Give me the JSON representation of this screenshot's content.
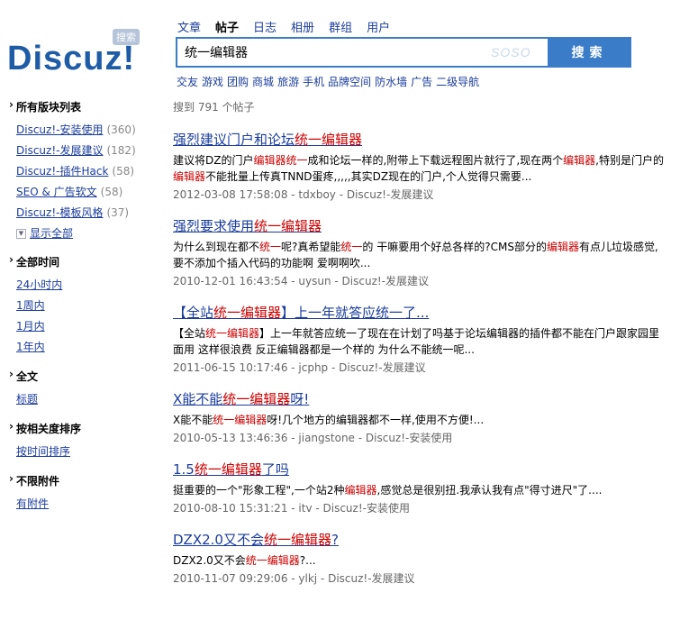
{
  "logo": {
    "text": "Discuz!",
    "badge": "搜索"
  },
  "tabs": [
    {
      "label": "文章",
      "active": false
    },
    {
      "label": "帖子",
      "active": true
    },
    {
      "label": "日志",
      "active": false
    },
    {
      "label": "相册",
      "active": false
    },
    {
      "label": "群组",
      "active": false
    },
    {
      "label": "用户",
      "active": false
    }
  ],
  "search": {
    "value": "统一编辑器",
    "brand": "SOSO",
    "button": "搜索"
  },
  "quicklinks": [
    "交友",
    "游戏",
    "团购",
    "商城",
    "旅游",
    "手机",
    "品牌空间",
    "防水墙",
    "广告",
    "二级导航"
  ],
  "sidebar": {
    "forums_title": "所有版块列表",
    "forums": [
      {
        "label": "Discuz!-安装使用",
        "count": "(360)"
      },
      {
        "label": "Discuz!-发展建议",
        "count": "(182)"
      },
      {
        "label": "Discuz!-插件Hack",
        "count": "(58)"
      },
      {
        "label": "SEO & 广告软文",
        "count": "(58)"
      },
      {
        "label": "Discuz!-模板风格",
        "count": "(37)"
      }
    ],
    "show_all": "显示全部",
    "time_title": "全部时间",
    "time_items": [
      "24小时内",
      "1周内",
      "1月内",
      "1年内"
    ],
    "fulltext_title": "全文",
    "fulltext_items": [
      "标题"
    ],
    "sort_title": "按相关度排序",
    "sort_items": [
      "按时间排序"
    ],
    "attach_title": "不限附件",
    "attach_items": [
      "有附件"
    ]
  },
  "results": {
    "count_text": "搜到 791 个帖子",
    "items": [
      {
        "title": [
          {
            "t": "强烈建议门户和论坛"
          },
          {
            "t": "统一编辑器",
            "h": true
          }
        ],
        "snippet": [
          {
            "t": "建议将DZ的门户"
          },
          {
            "t": "编辑器",
            "h": true
          },
          {
            "t": "统一",
            "h": true
          },
          {
            "t": "成和论坛一样的,附带上下载远程图片就行了,现在两个"
          },
          {
            "t": "编辑器",
            "h": true
          },
          {
            "t": ",特别是门户的"
          },
          {
            "t": "编辑器",
            "h": true
          },
          {
            "t": "不能批量上传真TNND蛋疼,,,,,其实DZ现在的门户,个人觉得只需要..."
          }
        ],
        "meta": "2012-03-08 17:58:08 - tdxboy - Discuz!-发展建议"
      },
      {
        "title": [
          {
            "t": "强烈要求使用"
          },
          {
            "t": "统一编辑器",
            "h": true
          }
        ],
        "snippet": [
          {
            "t": "为什么到现在都不"
          },
          {
            "t": "统一",
            "h": true
          },
          {
            "t": "呢?真希望能"
          },
          {
            "t": "统一",
            "h": true
          },
          {
            "t": "的 干嘛要用个好总各样的?CMS部分的"
          },
          {
            "t": "编辑器",
            "h": true
          },
          {
            "t": "有点儿垃圾感觉,要不添加个插入代码的功能啊 爱啊啊吹..."
          }
        ],
        "meta": "2010-12-01 16:43:54 - uysun - Discuz!-发展建议"
      },
      {
        "title": [
          {
            "t": "【全站"
          },
          {
            "t": "统一编辑器",
            "h": true
          },
          {
            "t": "】上一年就答应统一了..."
          }
        ],
        "snippet": [
          {
            "t": "【全站"
          },
          {
            "t": "统一编辑器",
            "h": true
          },
          {
            "t": "】上一年就答应统一了现在在计划了吗基于论坛编辑器的插件都不能在门户跟家园里面用 这样很浪费 反正编辑器都是一个样的 为什么不能统一呢..."
          }
        ],
        "meta": "2011-06-15 10:17:46 - jcphp - Discuz!-发展建议"
      },
      {
        "title": [
          {
            "t": "X能不能"
          },
          {
            "t": "统一编辑器",
            "h": true
          },
          {
            "t": "呀!"
          }
        ],
        "snippet": [
          {
            "t": "X能不能"
          },
          {
            "t": "统一编辑器",
            "h": true
          },
          {
            "t": "呀!几个地方的编辑器都不一样,使用不方便!..."
          }
        ],
        "meta": "2010-05-13 13:46:36 - jiangstone - Discuz!-安装使用"
      },
      {
        "title": [
          {
            "t": "1.5"
          },
          {
            "t": "统一编辑器",
            "h": true
          },
          {
            "t": "了吗"
          }
        ],
        "snippet": [
          {
            "t": "挺重要的一个\"形象工程\",一个站2种"
          },
          {
            "t": "编辑器",
            "h": true
          },
          {
            "t": ",感觉总是很别扭.我承认我有点\"得寸进尺\"了...."
          }
        ],
        "meta": "2010-08-10 15:31:21 - itv - Discuz!-安装使用"
      },
      {
        "title": [
          {
            "t": "DZX2.0又不会"
          },
          {
            "t": "统一编辑器",
            "h": true
          },
          {
            "t": "?"
          }
        ],
        "snippet": [
          {
            "t": "DZX2.0又不会"
          },
          {
            "t": "统一编辑器",
            "h": true
          },
          {
            "t": "?..."
          }
        ],
        "meta": "2010-11-07 09:29:06 - ylkj - Discuz!-发展建议"
      }
    ]
  }
}
